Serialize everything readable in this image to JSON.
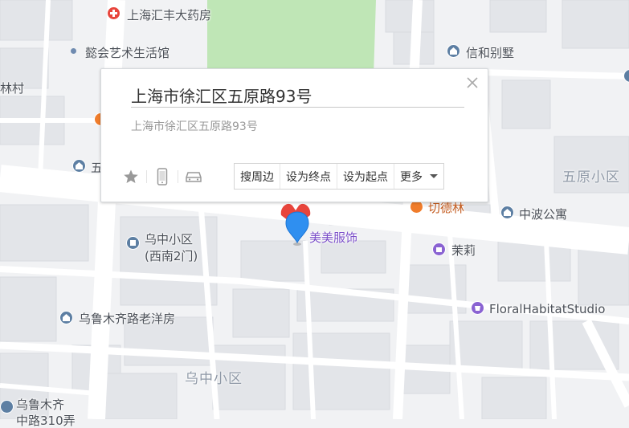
{
  "popup": {
    "title": "上海市徐汇区五原路93号",
    "address": "上海市徐汇区五原路93号",
    "actions": {
      "search_nearby": "搜周边",
      "set_destination": "设为终点",
      "set_start": "设为起点",
      "more": "更多"
    }
  },
  "pois": {
    "pharmacy": "上海汇丰大药房",
    "art_hall": "懿会艺术生活馆",
    "xinhe_villa": "信和别墅",
    "lin_cun": "林村",
    "five_partial": "五",
    "wuyuan_community": "五原小区",
    "orange_poi": "切德林",
    "zhongbo_apt": "中波公寓",
    "wuzhong_gate_line1": "乌中小区",
    "wuzhong_gate_line2": "(西南2门)",
    "meimei_clothing": "美美服饰",
    "moli": "茉莉",
    "floral_studio": "FloralHabitatStudio",
    "wulumuqi_house": "乌鲁木齐路老洋房",
    "wuzhong_community": "乌中小区",
    "wulumuqi_partial_line1": "乌鲁木齐",
    "wulumuqi_partial_line2": "中路310弄"
  },
  "icons": {
    "close": "close-icon",
    "favorite": "star-icon",
    "phone": "phone-icon",
    "car": "car-icon",
    "marker": "map-pin-icon"
  },
  "colors": {
    "map_background": "#f1f2f4",
    "road": "#ffffff",
    "block": "#e4e6ea",
    "park": "#bfe6b6",
    "marker_blue": "#2f8ff0",
    "marker_red": "#e8453c",
    "poi_blue": "#5d7fa3",
    "poi_purple": "#8a63d2",
    "poi_orange": "#f07c2b"
  }
}
